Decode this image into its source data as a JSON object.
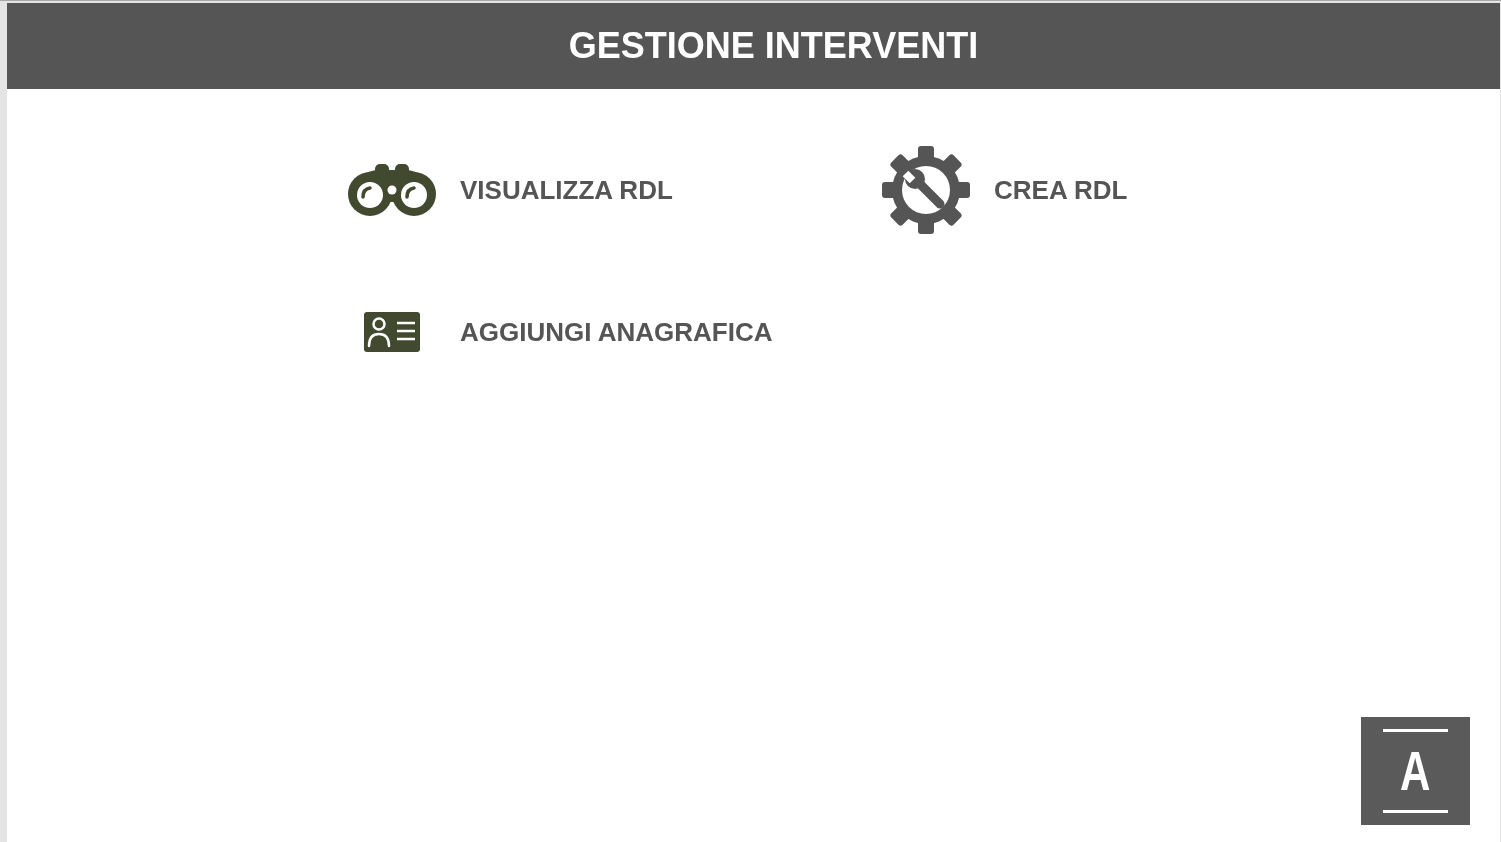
{
  "header": {
    "title": "GESTIONE INTERVENTI"
  },
  "menu": [
    {
      "label": "VISUALIZZA RDL"
    },
    {
      "label": "CREA RDL"
    },
    {
      "label": "AGGIUNGI ANAGRAFICA"
    }
  ],
  "logo": {
    "text": "A"
  }
}
